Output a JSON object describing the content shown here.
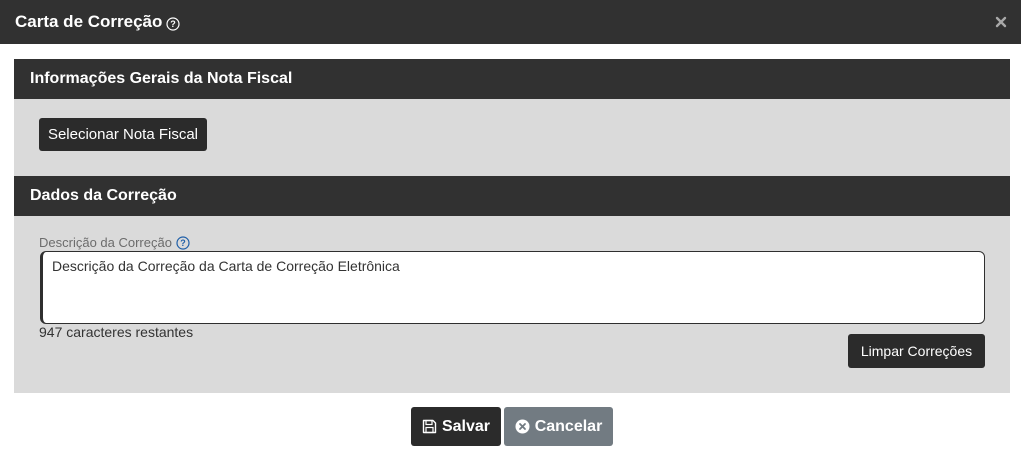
{
  "modal": {
    "title": "Carta de Correção",
    "close_glyph": "×"
  },
  "sections": {
    "general": {
      "title": "Informações Gerais da Nota Fiscal",
      "select_button_label": "Selecionar Nota Fiscal"
    },
    "correction": {
      "title": "Dados da Correção",
      "field_label": "Descrição da Correção",
      "field_value": "Descrição da Correção da Carta de Correção Eletrônica",
      "remaining_text": "947 caracteres restantes",
      "clear_button_label": "Limpar Correções"
    }
  },
  "footer": {
    "save_label": "Salvar",
    "cancel_label": "Cancelar"
  },
  "icons": {
    "title_help": "question-circle-icon",
    "field_help": "question-circle-icon",
    "close": "close-icon",
    "save": "floppy-disk-icon",
    "cancel": "x-circle-icon"
  },
  "colors": {
    "header_bg": "#313131",
    "section_bg": "#dadada",
    "button_dark": "#2b2b2b",
    "button_secondary": "#727b82",
    "help_icon_blue": "#1f5fa8"
  }
}
